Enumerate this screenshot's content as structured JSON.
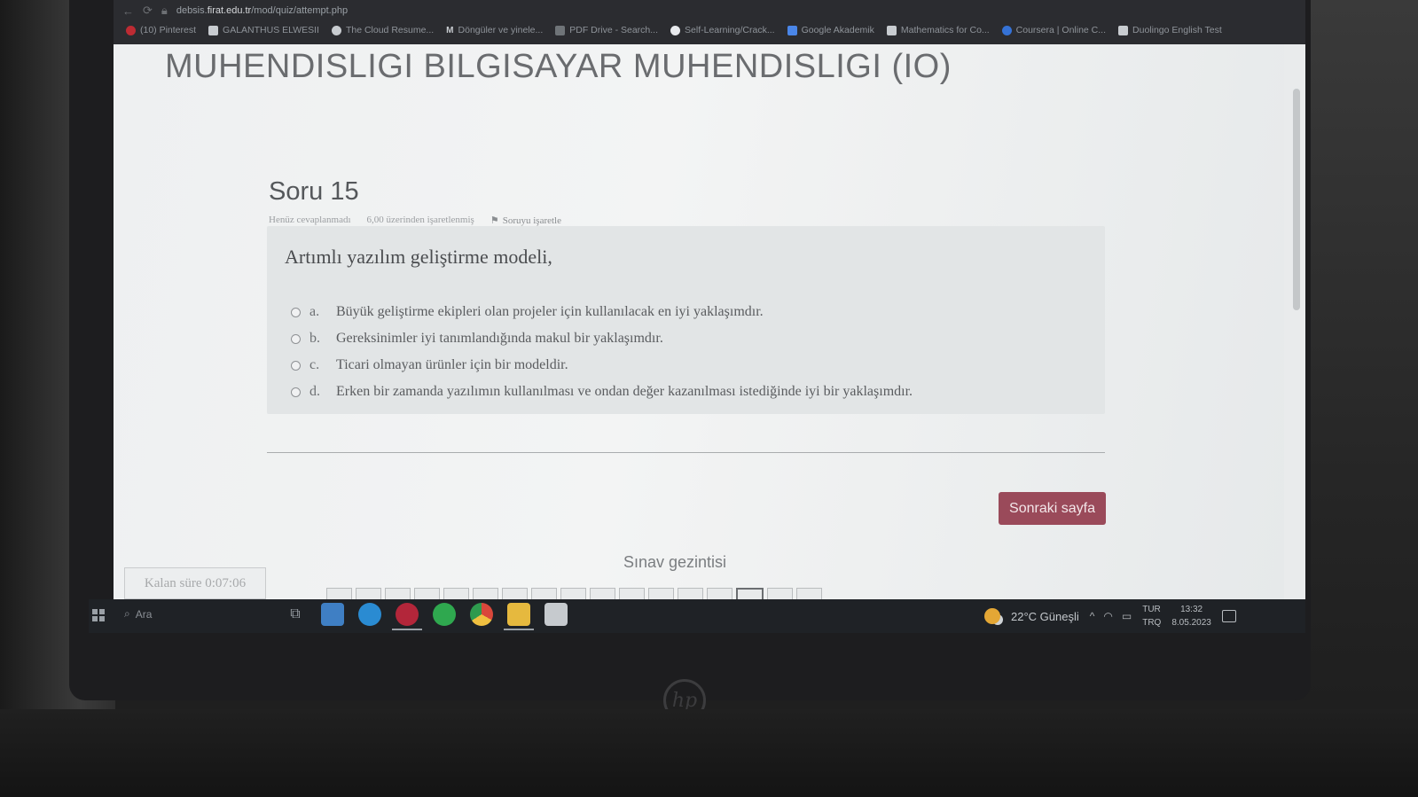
{
  "browser": {
    "url_prefix": "debsis.",
    "url_host": "firat.edu.tr",
    "url_path": "/mod/quiz/attempt.php",
    "bookmarks": [
      {
        "label": "(10) Pinterest",
        "color": "#bd2b33"
      },
      {
        "label": "GALANTHUS ELWESII",
        "color": "#c8ccd0"
      },
      {
        "label": "The Cloud Resume...",
        "color": "#c8ccd0"
      },
      {
        "label": "Döngüler ve yinele...",
        "color": "#c8ccd0"
      },
      {
        "label": "PDF Drive - Search...",
        "color": "#c8ccd0"
      },
      {
        "label": "Self-Learning/Crack...",
        "color": "#c8ccd0"
      },
      {
        "label": "Google Akademik",
        "color": "#4a86e8"
      },
      {
        "label": "Mathematics for Co...",
        "color": "#c8ccd0"
      },
      {
        "label": "Coursera | Online C...",
        "color": "#3572d6"
      },
      {
        "label": "Duolingo English Test",
        "color": "#c8ccd0"
      }
    ]
  },
  "page": {
    "course_title": "MUHENDISLIGI BILGISAYAR MUHENDISLIGI (IO)",
    "question_number": "Soru 15",
    "status": "Henüz cevaplanmadı",
    "marks": "6,00 üzerinden işaretlenmiş",
    "flag_label": "Soruyu işaretle",
    "question_text": "Artımlı yazılım geliştirme modeli,",
    "options": [
      {
        "letter": "a.",
        "text": "Büyük geliştirme ekipleri olan projeler için kullanılacak en iyi yaklaşımdır."
      },
      {
        "letter": "b.",
        "text": "Gereksinimler iyi tanımlandığında makul bir yaklaşımdır."
      },
      {
        "letter": "c.",
        "text": "Ticari olmayan ürünler için bir modeldir."
      },
      {
        "letter": "d.",
        "text": "Erken bir zamanda yazılımın kullanılması ve ondan değer kazanılması istediğinde iyi bir yaklaşımdır."
      }
    ],
    "next_button": "Sonraki sayfa",
    "nav_title": "Sınav gezintisi",
    "timer": "Kalan süre 0:07:06",
    "accent_color": "#9a4a5a"
  },
  "taskbar": {
    "search_placeholder": "Ara",
    "weather": "22°C Güneşli",
    "lang_top": "TUR",
    "lang_bottom": "TRQ",
    "time": "13:32",
    "date": "8.05.2023"
  }
}
